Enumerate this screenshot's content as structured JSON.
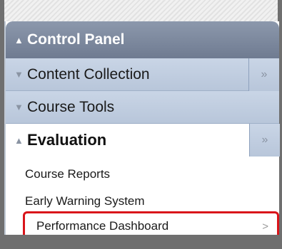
{
  "control_panel": {
    "title": "Control Panel",
    "expanded": true
  },
  "menu": {
    "content_collection": {
      "label": "Content Collection",
      "side_arrow": "»"
    },
    "course_tools": {
      "label": "Course Tools"
    },
    "evaluation": {
      "label": "Evaluation",
      "side_arrow": "»",
      "items": [
        {
          "label": "Course Reports"
        },
        {
          "label": "Early Warning System"
        },
        {
          "label": "Performance Dashboard",
          "arrow": ">"
        }
      ]
    }
  },
  "icons": {
    "expand": "chevron-up-icon",
    "collapse": "chevron-down-icon"
  },
  "colors": {
    "header": "#7e8aa0",
    "row": "#c2cfe2",
    "highlight": "#d9141a"
  }
}
